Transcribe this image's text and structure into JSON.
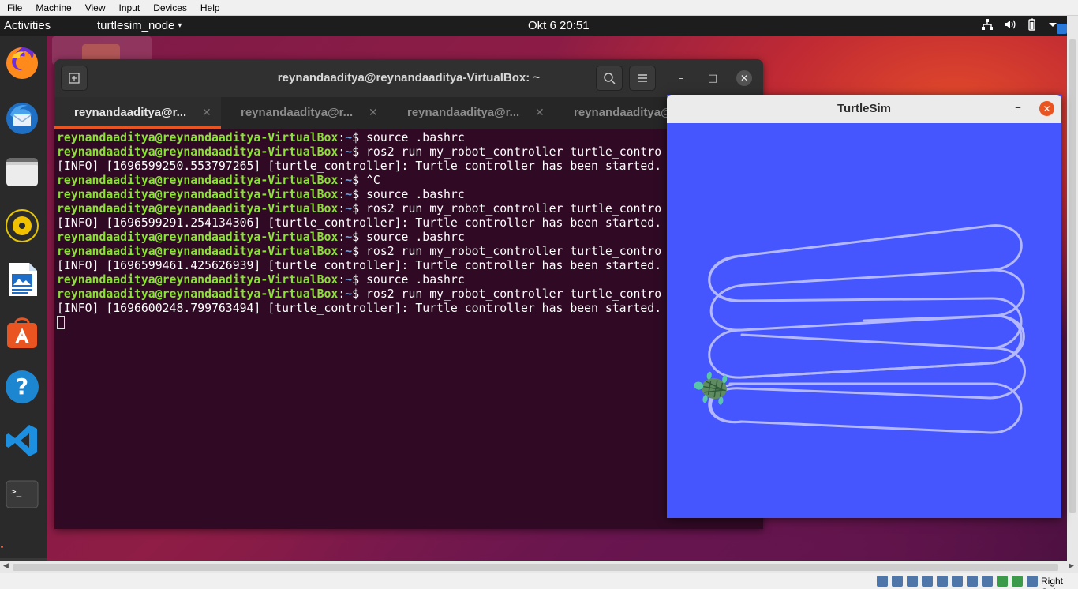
{
  "vbox_menu": [
    "File",
    "Machine",
    "View",
    "Input",
    "Devices",
    "Help"
  ],
  "topbar": {
    "activities": "Activities",
    "app_name": "turtlesim_node",
    "app_caret": "▾",
    "clock": "Okt 6  20:51",
    "tray_icons": [
      "network-icon",
      "volume-icon",
      "battery-icon",
      "system-menu-icon"
    ]
  },
  "dock": {
    "apps": [
      "firefox",
      "thunderbird",
      "files",
      "rhythmbox",
      "libreoffice-writer",
      "ubuntu-software",
      "help",
      "vscode",
      "terminal"
    ]
  },
  "terminal": {
    "title": "reynandaaditya@reynandaaditya-VirtualBox: ~",
    "new_tab_glyph": "⊞",
    "search_glyph": "⌕",
    "menu_glyph": "☰",
    "minimize_glyph": "–",
    "maximize_glyph": "□",
    "close_glyph": "✕",
    "tabs": [
      {
        "label": "reynandaaditya@r...",
        "close": "✕"
      },
      {
        "label": "reynandaaditya@r...",
        "close": "✕"
      },
      {
        "label": "reynandaaditya@r...",
        "close": "✕"
      },
      {
        "label": "reynandaaditya@r...",
        "close": "✕"
      }
    ],
    "prompt_user": "reynandaaditya@reynandaaditya-VirtualBox",
    "prompt_sep": ":",
    "prompt_path": "~",
    "prompt_dollar": "$ ",
    "lines": [
      {
        "type": "prompt",
        "cmd": "source .bashrc"
      },
      {
        "type": "prompt",
        "cmd": "ros2 run my_robot_controller turtle_contro"
      },
      {
        "type": "output",
        "text": "[INFO] [1696599250.553797265] [turtle_controller]: Turtle controller has been started."
      },
      {
        "type": "prompt",
        "cmd": "^C"
      },
      {
        "type": "prompt",
        "cmd": "source .bashrc"
      },
      {
        "type": "prompt",
        "cmd": "ros2 run my_robot_controller turtle_contro"
      },
      {
        "type": "output",
        "text": "[INFO] [1696599291.254134306] [turtle_controller]: Turtle controller has been started."
      },
      {
        "type": "prompt",
        "cmd": "source .bashrc"
      },
      {
        "type": "prompt",
        "cmd": "ros2 run my_robot_controller turtle_contro"
      },
      {
        "type": "output",
        "text": "[INFO] [1696599461.425626939] [turtle_controller]: Turtle controller has been started."
      },
      {
        "type": "prompt",
        "cmd": "source .bashrc"
      },
      {
        "type": "prompt",
        "cmd": "ros2 run my_robot_controller turtle_contro"
      },
      {
        "type": "output",
        "text": "[INFO] [1696600248.799763494] [turtle_controller]: Turtle controller has been started."
      }
    ]
  },
  "turtlesim": {
    "title": "TurtleSim",
    "minimize_glyph": "–",
    "close_glyph": "✕",
    "background_color": "#4556ff",
    "pen_color": "#b3b8ff"
  },
  "vbox_status": {
    "host_key": "Right Ctrl"
  }
}
